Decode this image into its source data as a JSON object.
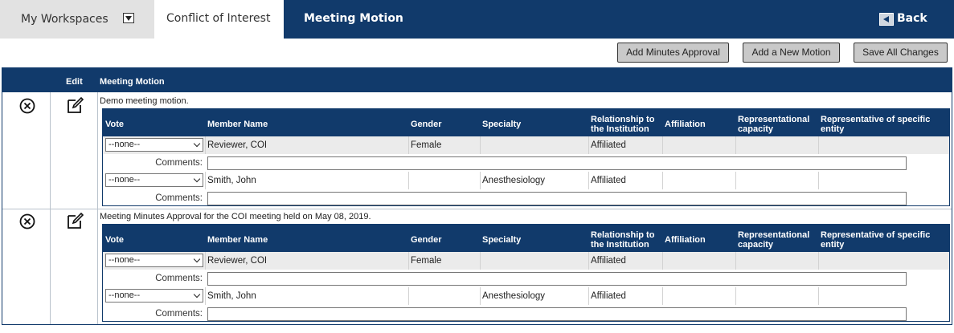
{
  "nav": {
    "workspaces_label": "My Workspaces",
    "tab_coi": "Conflict of Interest",
    "tab_meeting_motion": "Meeting Motion",
    "back_label": "Back"
  },
  "toolbar": {
    "add_minutes_approval": "Add Minutes Approval",
    "add_new_motion": "Add a New Motion",
    "save_all_changes": "Save All Changes"
  },
  "grid": {
    "header_edit": "Edit",
    "header_meeting_motion": "Meeting Motion"
  },
  "inner_headers": {
    "vote": "Vote",
    "member_name": "Member Name",
    "gender": "Gender",
    "specialty": "Specialty",
    "relationship_1": "Relationship to",
    "relationship_2": "the Institution",
    "affiliation": "Affiliation",
    "rep_capacity_1": "Representational",
    "rep_capacity_2": "capacity",
    "rep_entity_1": "Representative of specific",
    "rep_entity_2": "entity"
  },
  "comments_label": "Comments:",
  "motions": [
    {
      "text": "Demo meeting motion.",
      "members": [
        {
          "vote": "--none--",
          "name": "Reviewer, COI",
          "gender": "Female",
          "specialty": "",
          "relationship": "Affiliated",
          "affiliation": "",
          "rep_capacity": "",
          "rep_entity": "",
          "comment": ""
        },
        {
          "vote": "--none--",
          "name": "Smith, John",
          "gender": "",
          "specialty": "Anesthesiology",
          "relationship": "Affiliated",
          "affiliation": "",
          "rep_capacity": "",
          "rep_entity": "",
          "comment": ""
        }
      ]
    },
    {
      "text": "Meeting Minutes Approval for the COI meeting held on May 08, 2019.",
      "members": [
        {
          "vote": "--none--",
          "name": "Reviewer, COI",
          "gender": "Female",
          "specialty": "",
          "relationship": "Affiliated",
          "affiliation": "",
          "rep_capacity": "",
          "rep_entity": "",
          "comment": ""
        },
        {
          "vote": "--none--",
          "name": "Smith, John",
          "gender": "",
          "specialty": "Anesthesiology",
          "relationship": "Affiliated",
          "affiliation": "",
          "rep_capacity": "",
          "rep_entity": "",
          "comment": ""
        }
      ]
    }
  ],
  "colors": {
    "nav_blue": "#113a6b",
    "button_gray": "#c9c9c9",
    "row_gray": "#ebebeb"
  }
}
